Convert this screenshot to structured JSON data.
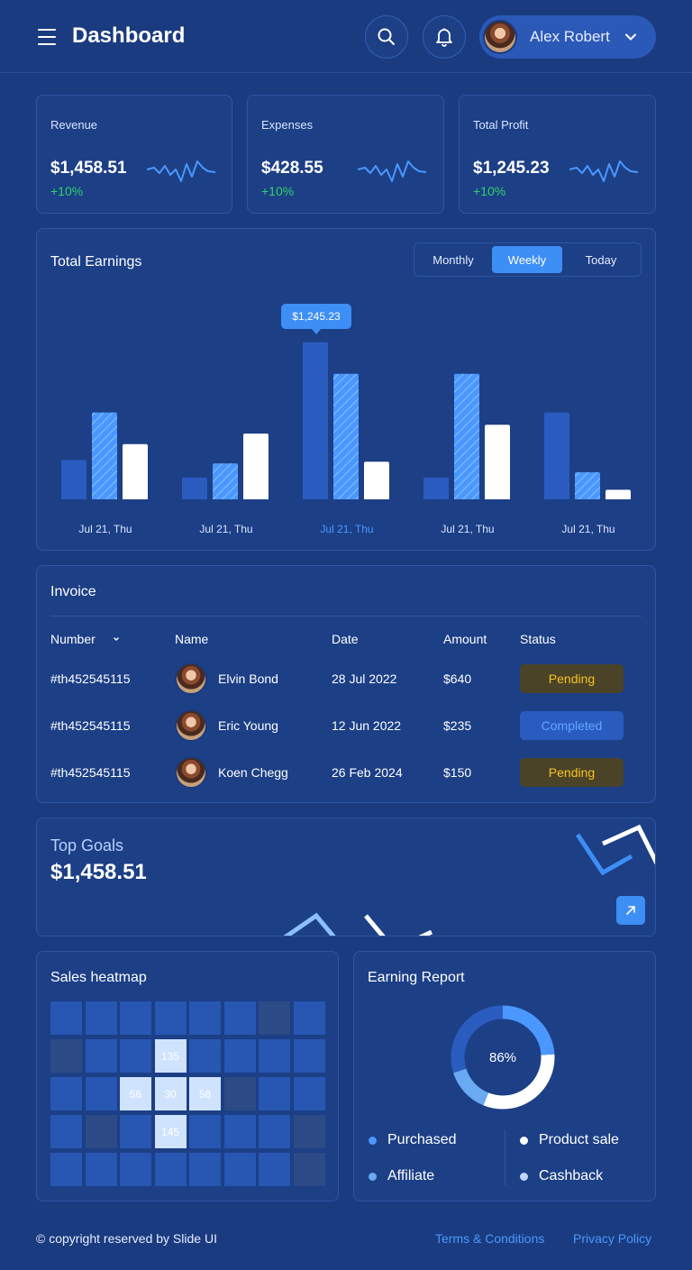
{
  "header": {
    "title": "Dashboard",
    "menu_icon": "hamburger-menu-icon",
    "search_icon": "search-icon",
    "bell_icon": "bell-icon",
    "user_name": "Alex Robert",
    "user_chevron_icon": "chevron-down-icon"
  },
  "stats": [
    {
      "label": "Revenue",
      "value": "$1,458.51",
      "change": "+10%"
    },
    {
      "label": "Expenses",
      "value": "$428.55",
      "change": "+10%"
    },
    {
      "label": "Total Profit",
      "value": "$1,245.23",
      "change": "+10%"
    }
  ],
  "colors": {
    "background": "#1a3b7f",
    "card": "#1c3f86",
    "accent": "#3d8ef5",
    "positive": "#2fd36b",
    "pending": "#f6c324",
    "completed": "#62a6ff"
  },
  "earnings": {
    "title": "Total Earnings",
    "tabs": [
      "Monthly",
      "Weekly",
      "Today"
    ],
    "active_tab": "Weekly",
    "tooltip": "$1,245.23"
  },
  "chart_data": {
    "type": "bar",
    "title": "Total Earnings",
    "categories": [
      "Jul 21, Thu",
      "Jul 21, Thu",
      "Jul 21, Thu",
      "Jul 21, Thu",
      "Jul 21, Thu"
    ],
    "highlighted_category_index": 2,
    "series": [
      {
        "values": [
          25,
          15,
          92,
          15,
          52
        ],
        "color": "#2a5cc0"
      },
      {
        "values": [
          52,
          23,
          74,
          74,
          18
        ],
        "color": "#4a98ff",
        "pattern": "striped"
      },
      {
        "values": [
          34,
          40,
          24,
          45,
          8
        ],
        "color": "#ffffff"
      }
    ],
    "ylim": [
      0,
      100
    ],
    "grid": false
  },
  "invoice": {
    "title": "Invoice",
    "columns": [
      "Number",
      "Name",
      "Date",
      "Amount",
      "Status"
    ],
    "sort_icon": "chevron-down-icon",
    "rows": [
      {
        "number": "#th452545115",
        "name": "Elvin Bond",
        "date": "28 Jul 2022",
        "amount": "$640",
        "status": "Pending"
      },
      {
        "number": "#th452545115",
        "name": "Eric Young",
        "date": "12 Jun 2022",
        "amount": "$235",
        "status": "Completed"
      },
      {
        "number": "#th452545115",
        "name": "Koen Chegg",
        "date": "26 Feb 2024",
        "amount": "$150",
        "status": "Pending"
      }
    ]
  },
  "goals": {
    "title": "Top Goals",
    "value": "$1,458.51",
    "arrow_icon": "arrow-up-right-icon"
  },
  "heatmap": {
    "title": "Sales heatmap",
    "rows": [
      [
        "",
        "",
        "",
        "",
        "",
        "",
        "",
        ""
      ],
      [
        "",
        "",
        "",
        "135",
        "",
        "",
        "",
        ""
      ],
      [
        "",
        "",
        "56",
        "30",
        "58",
        "",
        "",
        ""
      ],
      [
        "",
        "",
        "",
        "145",
        "",
        "",
        "",
        ""
      ],
      [
        "",
        "",
        "",
        "",
        "",
        "",
        "",
        ""
      ]
    ],
    "levels": [
      [
        "mid",
        "mid",
        "mid",
        "mid",
        "mid",
        "mid",
        "dim",
        "mid"
      ],
      [
        "dim",
        "mid",
        "mid",
        "hot",
        "mid",
        "mid",
        "mid",
        "mid"
      ],
      [
        "mid",
        "mid",
        "hot",
        "hot",
        "hot",
        "dim",
        "mid",
        "mid"
      ],
      [
        "mid",
        "dim",
        "mid",
        "hot",
        "mid",
        "mid",
        "mid",
        "dim"
      ],
      [
        "mid",
        "mid",
        "mid",
        "mid",
        "mid",
        "mid",
        "mid",
        "dim"
      ]
    ]
  },
  "report": {
    "title": "Earning Report",
    "percent": "86%",
    "segments": [
      {
        "label": "Purchased",
        "color": "#4a98ff",
        "share": 0.24
      },
      {
        "label": "Product sale",
        "color": "#ffffff",
        "share": 0.32
      },
      {
        "label": "Affiliate",
        "color": "#6aaaf2",
        "share": 0.14
      },
      {
        "label": "Cashback",
        "color": "#2a5cc0",
        "share": 0.3
      }
    ]
  },
  "footer": {
    "copyright": "© copyright reserved by Slide UI",
    "links": [
      "Terms & Conditions",
      "Privacy Policy"
    ]
  }
}
